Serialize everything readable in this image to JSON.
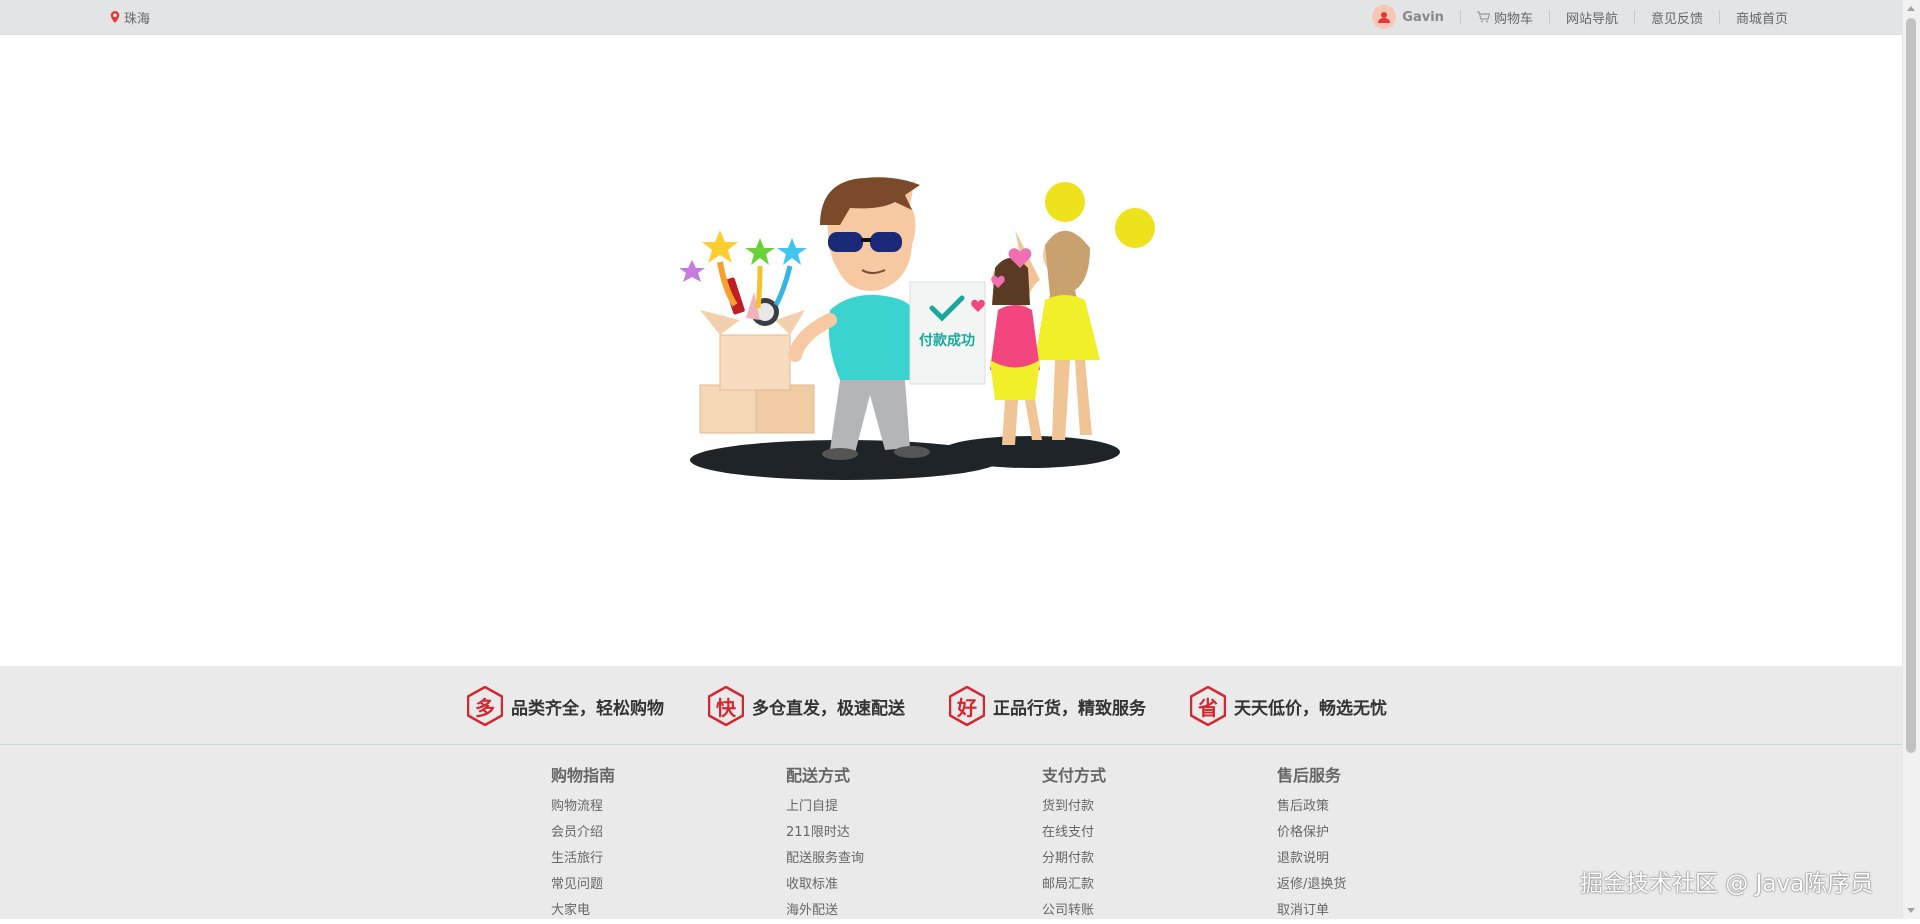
{
  "topbar": {
    "location": "珠海",
    "user": "Gavin",
    "cart": "购物车",
    "site_nav": "网站导航",
    "feedback": "意见反馈",
    "home": "商城首页"
  },
  "illustration": {
    "badge_text": "付款成功"
  },
  "features": [
    {
      "char": "多",
      "text": "品类齐全，轻松购物"
    },
    {
      "char": "快",
      "text": "多仓直发，极速配送"
    },
    {
      "char": "好",
      "text": "正品行货，精致服务"
    },
    {
      "char": "省",
      "text": "天天低价，畅选无忧"
    }
  ],
  "guide": [
    {
      "title": "购物指南",
      "links": [
        "购物流程",
        "会员介绍",
        "生活旅行",
        "常见问题",
        "大家电"
      ]
    },
    {
      "title": "配送方式",
      "links": [
        "上门自提",
        "211限时达",
        "配送服务查询",
        "收取标准",
        "海外配送"
      ]
    },
    {
      "title": "支付方式",
      "links": [
        "货到付款",
        "在线支付",
        "分期付款",
        "邮局汇款",
        "公司转账"
      ]
    },
    {
      "title": "售后服务",
      "links": [
        "售后政策",
        "价格保护",
        "退款说明",
        "返修/退换货",
        "取消订单"
      ]
    }
  ],
  "watermark": "掘金技术社区 @ Java陈序员",
  "colors": {
    "topbar_bg": "#e3e4e5",
    "footer_bg": "#eaeaea",
    "accent_red": "#d3262e",
    "success_teal": "#1aa79c"
  }
}
